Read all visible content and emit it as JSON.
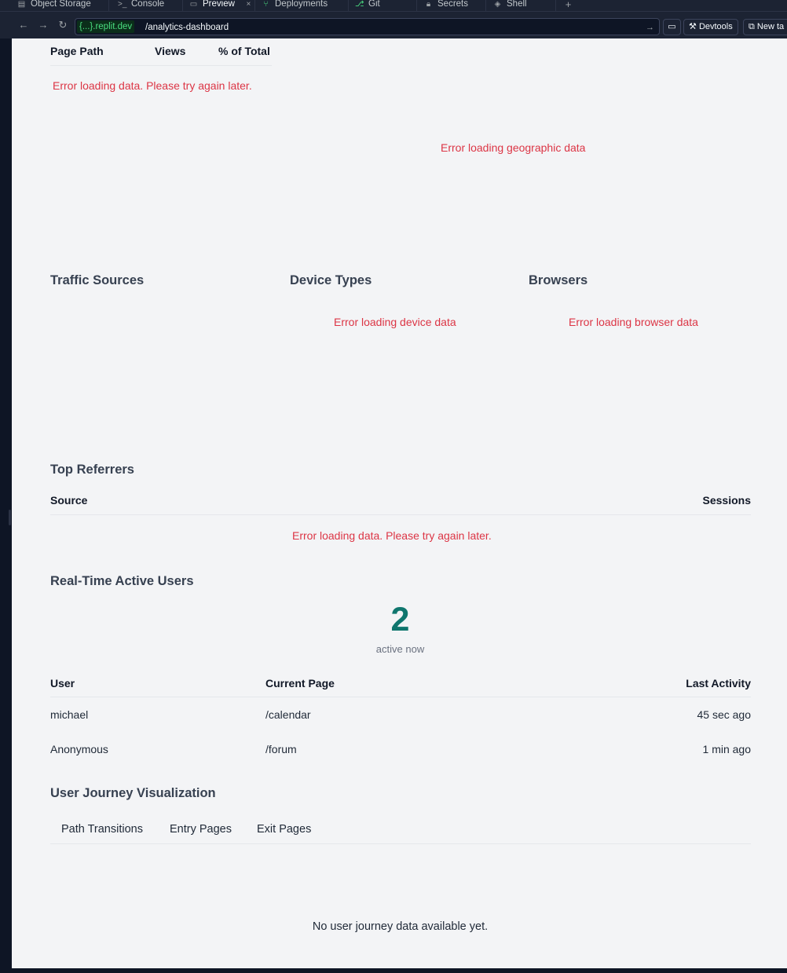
{
  "ide": {
    "tabs": [
      {
        "label": "Object Storage",
        "icon": "storage-icon",
        "active": false
      },
      {
        "label": "Console",
        "icon": "terminal-icon",
        "active": false
      },
      {
        "label": "Preview",
        "icon": "monitor-icon",
        "active": true
      },
      {
        "label": "Deployments",
        "icon": "deploy-icon",
        "active": false
      },
      {
        "label": "Git",
        "icon": "git-icon",
        "active": false
      },
      {
        "label": "Secrets",
        "icon": "lock-icon",
        "active": false
      },
      {
        "label": "Shell",
        "icon": "shell-icon",
        "active": false
      }
    ],
    "address": {
      "host": "{...}.replit.dev",
      "path": "/analytics-dashboard"
    },
    "devtools_label": "Devtools",
    "new_tab_label": "New ta"
  },
  "top_pages": {
    "headers": [
      "Page Path",
      "Views",
      "% of Total"
    ],
    "error": "Error loading data. Please try again later."
  },
  "geo": {
    "error": "Error loading geographic data"
  },
  "traffic_sources": {
    "title": "Traffic Sources"
  },
  "device_types": {
    "title": "Device Types",
    "error": "Error loading device data"
  },
  "browsers": {
    "title": "Browsers",
    "error": "Error loading browser data"
  },
  "referrers": {
    "title": "Top Referrers",
    "headers": [
      "Source",
      "Sessions"
    ],
    "error": "Error loading data. Please try again later."
  },
  "realtime": {
    "title": "Real-Time Active Users",
    "count": "2",
    "count_label": "active now",
    "headers": [
      "User",
      "Current Page",
      "Last Activity"
    ],
    "rows": [
      {
        "user": "michael",
        "page": "/calendar",
        "activity": "45 sec ago"
      },
      {
        "user": "Anonymous",
        "page": "/forum",
        "activity": "1 min ago"
      }
    ]
  },
  "journey": {
    "title": "User Journey Visualization",
    "tabs": [
      "Path Transitions",
      "Entry Pages",
      "Exit Pages"
    ],
    "empty": "No user journey data available yet."
  }
}
